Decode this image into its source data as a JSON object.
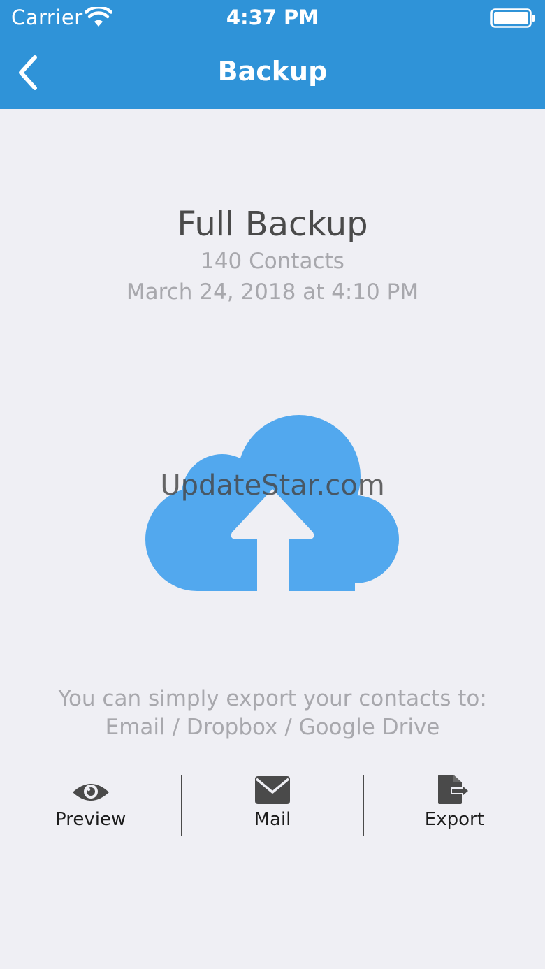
{
  "status_bar": {
    "carrier": "Carrier",
    "time": "4:37 PM"
  },
  "nav": {
    "title": "Backup",
    "back_icon": "chevron-left-icon"
  },
  "backup": {
    "title": "Full Backup",
    "count": "140 Contacts",
    "date": "March 24, 2018 at 4:10 PM"
  },
  "illustration": {
    "icon": "cloud-upload-icon",
    "color": "#52a8ee"
  },
  "watermark": "UpdateStar.com",
  "export_info": {
    "line1": "You can simply export your contacts to:",
    "line2": "Email / Dropbox / Google Drive"
  },
  "actions": [
    {
      "label": "Preview",
      "icon": "eye-icon"
    },
    {
      "label": "Mail",
      "icon": "envelope-icon"
    },
    {
      "label": "Export",
      "icon": "export-file-icon"
    }
  ],
  "colors": {
    "header": "#2f93d8",
    "background": "#efeff4",
    "muted_text": "#a8a8ad",
    "title_text": "#4a4a4a",
    "icon": "#4a4a4a"
  }
}
